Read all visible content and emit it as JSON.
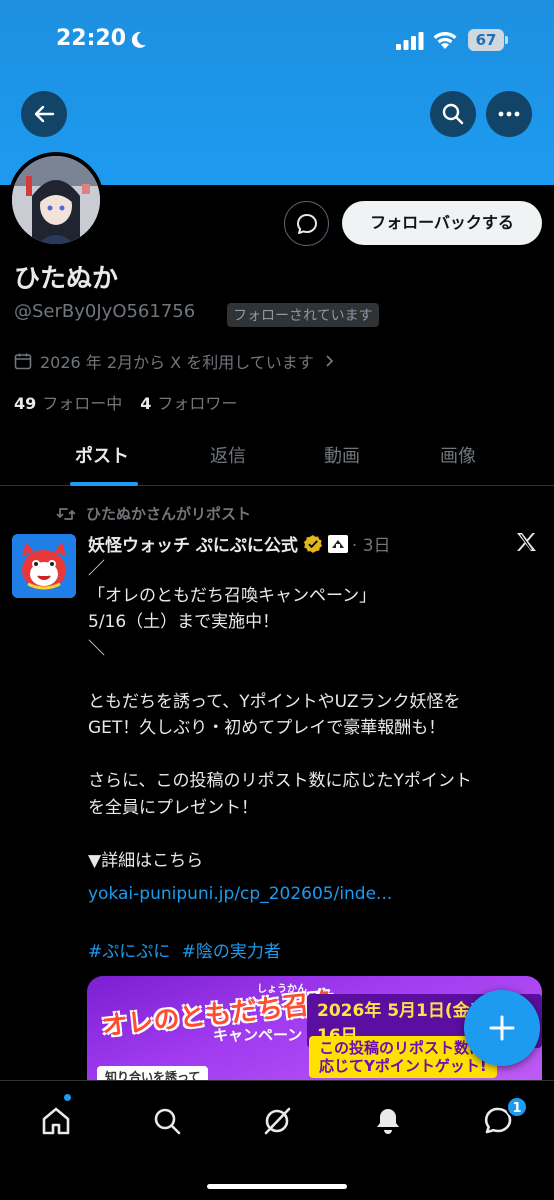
{
  "status_bar": {
    "time": "22:20",
    "battery": "67"
  },
  "profile": {
    "display_name": "ひたぬか",
    "handle": "@SerBy0JyO561756",
    "follows_you": "フォローされています",
    "joined": "2026 年 2月から X を利用しています",
    "following_count": "49",
    "following_label": "フォロー中",
    "followers_count": "4",
    "followers_label": "フォロワー",
    "follow_back_label": "フォローバックする"
  },
  "tabs": [
    {
      "label": "ポスト",
      "active": true
    },
    {
      "label": "返信",
      "active": false
    },
    {
      "label": "動画",
      "active": false
    },
    {
      "label": "画像",
      "active": false
    }
  ],
  "post": {
    "repost_label": "ひたぬかさんがリポスト",
    "author": "妖怪ウォッチ ぷにぷに公式",
    "time": "· 3日",
    "body": "／\n「オレのともだち召喚キャンペーン」\n5/16（土）まで実施中！\n＼\n\nともだちを誘って、YポイントやUZランク妖怪を\nGET！久しぶり・初めてプレイで豪華報酬も！\n\nさらに、この投稿のリポスト数に応じたYポイント\nを全員にプレゼント！\n\n▼詳細はこちら",
    "link": "yokai-punipuni.jp/cp_202605/inde...",
    "hashtags": [
      "#ぷにぷに",
      "#陰の実力者"
    ]
  },
  "media": {
    "title": "オレのともだち召喚",
    "subtitle": "キャンペーン",
    "reading": "しょうかん",
    "date": "2026年 5月1日(金)~5月16日",
    "banner_line1": "この投稿のリポスト数に",
    "banner_line2": "応じてYポイントゲット!",
    "small_text": "知り合いを誘って"
  },
  "nav": {
    "messages_badge": "1"
  },
  "colors": {
    "accent": "#1d9bf0",
    "background": "#000000",
    "secondary_text": "#71767b"
  }
}
